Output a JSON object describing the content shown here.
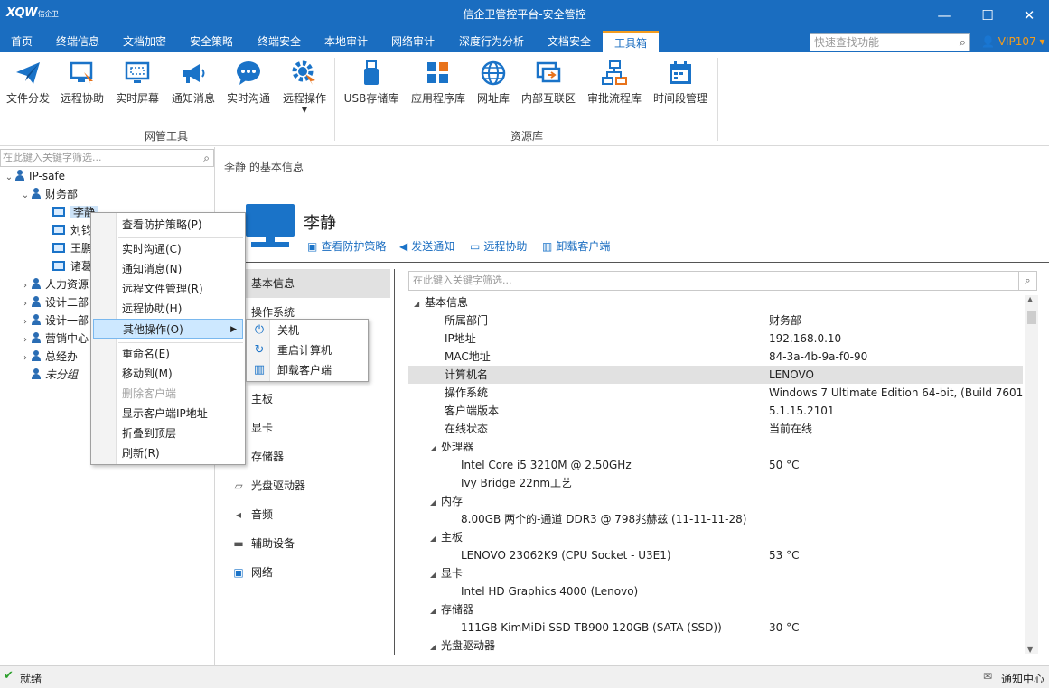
{
  "window": {
    "logo": "XQW",
    "logo_sub": "信企卫",
    "title": "信企卫管控平台-安全管控",
    "min_glyph": "—",
    "max_glyph": "☐",
    "close_glyph": "✕"
  },
  "menubar": {
    "items": [
      "首页",
      "终端信息",
      "文档加密",
      "安全策略",
      "终端安全",
      "本地审计",
      "网络审计",
      "深度行为分析",
      "文档安全",
      "工具箱"
    ],
    "active": "工具箱",
    "search_placeholder": "快速查找功能",
    "vip": "VIP107"
  },
  "ribbon": {
    "tools": [
      "文件分发",
      "远程协助",
      "实时屏幕",
      "通知消息",
      "实时沟通",
      "远程操作"
    ],
    "tools_group": "网管工具",
    "resources": [
      "USB存储库",
      "应用程序库",
      "网址库",
      "内部互联区",
      "审批流程库",
      "时间段管理"
    ],
    "resources_group": "资源库",
    "accent": "#1a73c8"
  },
  "tree": {
    "filter_placeholder": "在此键入关键字筛选...",
    "root": "IP-safe",
    "dept_finance": "财务部",
    "pcs": [
      "李静",
      "刘钧",
      "王鹏",
      "诸葛"
    ],
    "depts": [
      "人力资源",
      "设计二部",
      "设计一部",
      "营销中心",
      "总经办"
    ],
    "ungrouped": "未分组"
  },
  "context_menu": {
    "items": [
      "查看防护策略(P)",
      "实时沟通(C)",
      "通知消息(N)",
      "远程文件管理(R)",
      "远程协助(H)",
      "其他操作(O)",
      "重命名(E)",
      "移动到(M)",
      "删除客户端",
      "显示客户端IP地址",
      "折叠到顶层",
      "刷新(R)"
    ],
    "submenu": [
      "关机",
      "重启计算机",
      "卸载客户端"
    ]
  },
  "main": {
    "breadcrumb": "李静 的基本信息",
    "user_name": "李静",
    "actions": [
      "查看防护策略",
      "发送通知",
      "远程协助",
      "卸载客户端"
    ],
    "categories": [
      "基本信息",
      "操作系统",
      "主板",
      "显卡",
      "存储器",
      "光盘驱动器",
      "音频",
      "辅助设备",
      "网络"
    ],
    "prop_filter_placeholder": "在此键入关键字筛选...",
    "sections": {
      "basic": "基本信息",
      "cpu": "处理器",
      "mem": "内存",
      "board": "主板",
      "gpu": "显卡",
      "storage": "存储器",
      "optical": "光盘驱动器"
    },
    "basic_rows": [
      {
        "k": "所属部门",
        "v": "财务部"
      },
      {
        "k": "IP地址",
        "v": "192.168.0.10"
      },
      {
        "k": "MAC地址",
        "v": "84-3a-4b-9a-f0-90"
      },
      {
        "k": "计算机名",
        "v": "LENOVO"
      },
      {
        "k": "操作系统",
        "v": "Windows 7 Ultimate Edition 64-bit, (Build 7601)"
      },
      {
        "k": "客户端版本",
        "v": "5.1.15.2101"
      },
      {
        "k": "在线状态",
        "v": "当前在线"
      }
    ],
    "cpu_rows": [
      {
        "k": "Intel Core i5 3210M @ 2.50GHz",
        "v": "50 °C"
      },
      {
        "k": "Ivy Bridge 22nm工艺",
        "v": ""
      }
    ],
    "mem_rows": [
      {
        "k": "8.00GB 两个的-通道 DDR3 @ 798兆赫兹 (11-11-11-28)",
        "v": ""
      }
    ],
    "board_rows": [
      {
        "k": "LENOVO 23062K9 (CPU Socket - U3E1)",
        "v": "53 °C"
      }
    ],
    "gpu_rows": [
      {
        "k": "Intel HD Graphics 4000 (Lenovo)",
        "v": ""
      }
    ],
    "storage_rows": [
      {
        "k": "111GB KimMiDi SSD TB900 120GB (SATA (SSD))",
        "v": "30 °C"
      }
    ]
  },
  "statusbar": {
    "status": "就绪",
    "notify": "通知中心"
  }
}
